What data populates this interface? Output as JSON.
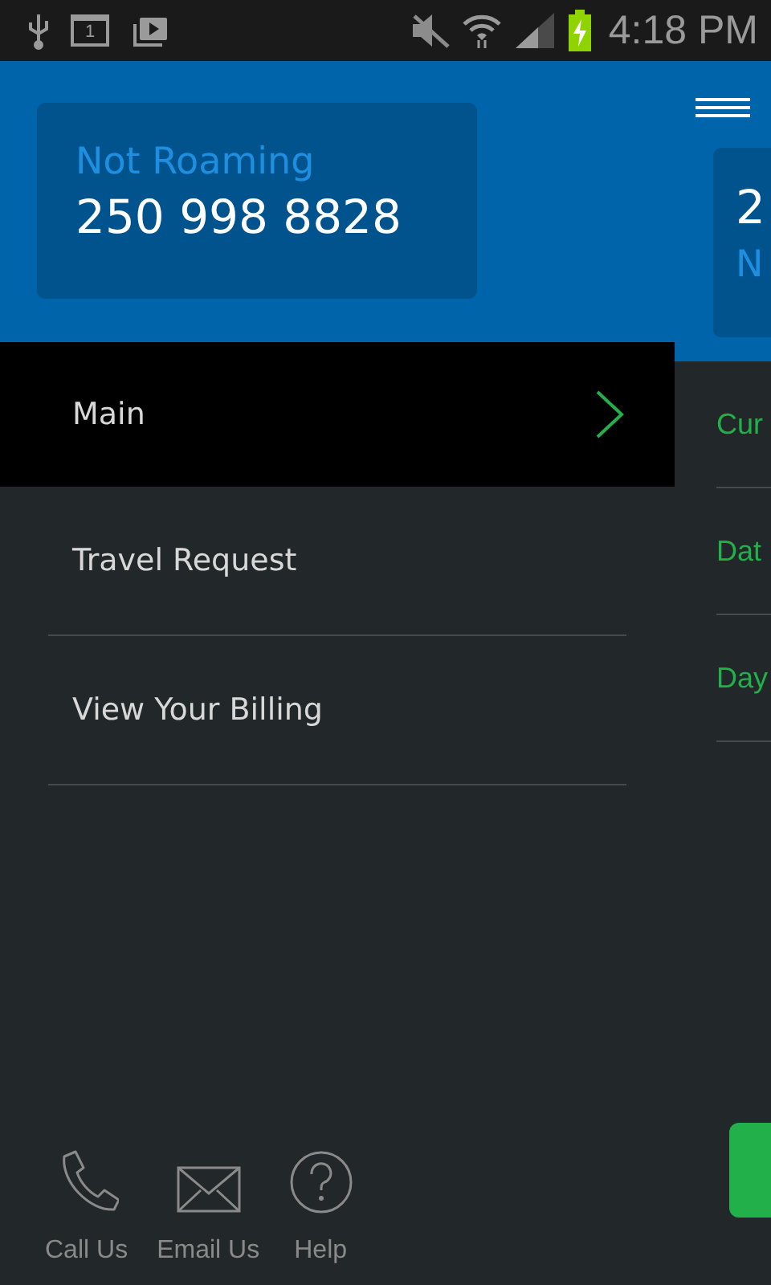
{
  "status_bar": {
    "calendar_day": "1",
    "time": "4:18 PM"
  },
  "drawer": {
    "account": {
      "status": "Not Roaming",
      "number": "250 998 8828"
    },
    "items": [
      {
        "label": "Main",
        "selected": true
      },
      {
        "label": "Travel Request",
        "selected": false
      },
      {
        "label": "View Your Billing",
        "selected": false
      }
    ],
    "footer": [
      {
        "kind": "phone",
        "label": "Call Us"
      },
      {
        "kind": "mail",
        "label": "Email Us"
      },
      {
        "kind": "help",
        "label": "Help"
      }
    ]
  },
  "background_page": {
    "card": {
      "line_1": "2",
      "line_2": "N"
    },
    "rows": [
      "Cur",
      "Dat",
      "Day"
    ]
  }
}
